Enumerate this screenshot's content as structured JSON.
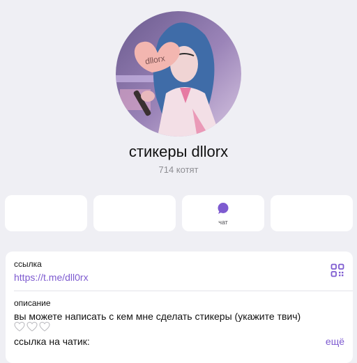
{
  "profile": {
    "name": "стикеры dllorx",
    "subscribers": "714 котят",
    "avatar_sign_text": "dllorx"
  },
  "actions": [
    {
      "label": ""
    },
    {
      "label": ""
    },
    {
      "label": "чат",
      "icon": "chat-bubble-icon"
    },
    {
      "label": ""
    }
  ],
  "info": {
    "link_label": "ссылка",
    "link_value": "https://t.me/dll0rx",
    "qr_icon": "qr-code-icon",
    "description_label": "описание",
    "description_text": "вы можете написать с кем мне сделать стикеры (укажите твич)",
    "hearts": "🤍🤍🤍",
    "chat_link_label": "ссылка на чатик:",
    "more_label": "ещё"
  },
  "colors": {
    "accent": "#7e5bd0",
    "background": "#efeff4",
    "card": "#ffffff",
    "secondary_text": "#8e8e93"
  }
}
